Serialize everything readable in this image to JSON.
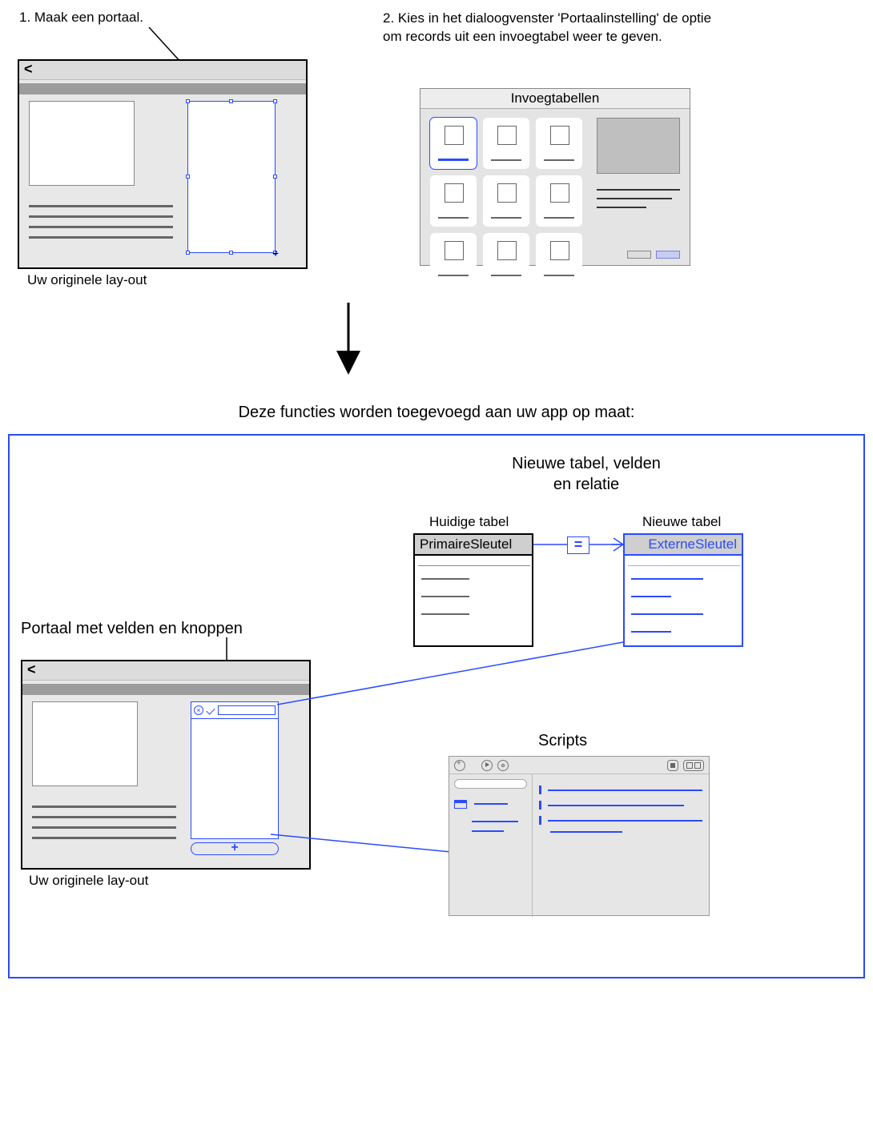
{
  "step1": {
    "text": "1. Maak een portaal.",
    "caption": "Uw originele lay-out",
    "back_symbol": "<"
  },
  "step2": {
    "text": "2. Kies in het dialoogvenster 'Portaalinstelling' de optie om records uit een invoegtabel weer te geven.",
    "dialog_title": "Invoegtabellen"
  },
  "middle_title": "Deze functies worden toegevoegd aan uw app op maat:",
  "result": {
    "tables_title": "Nieuwe tabel, velden\nen relatie",
    "current_table_label": "Huidige tabel",
    "new_table_label": "Nieuwe tabel",
    "current_key": "PrimaireSleutel",
    "new_key": "ExterneSleutel",
    "operator": "=",
    "portal_title": "Portaal met velden en knoppen",
    "portal_caption": "Uw originele lay-out",
    "back_symbol": "<",
    "add_symbol": "+",
    "scripts_title": "Scripts"
  }
}
